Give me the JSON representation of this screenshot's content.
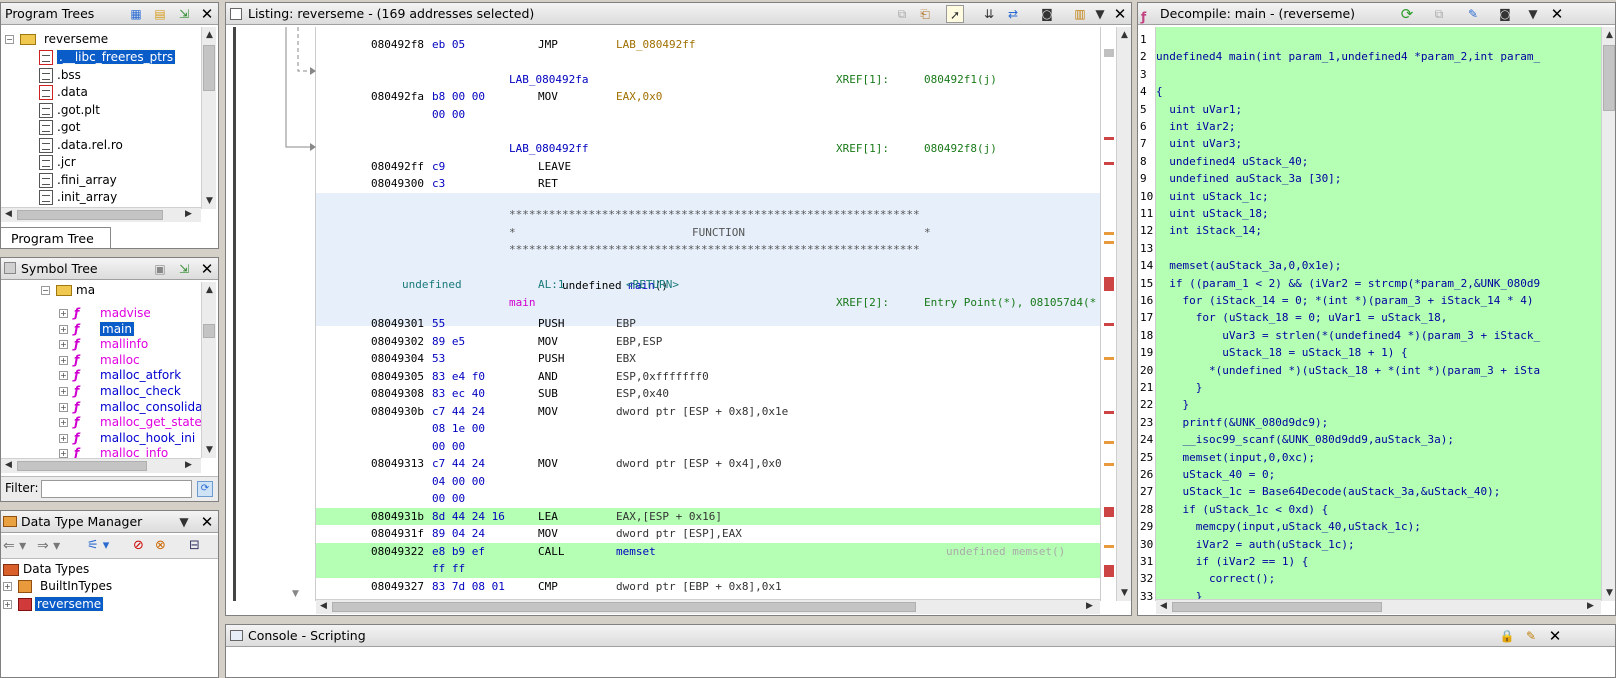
{
  "program_trees": {
    "title": "Program Trees",
    "root": "reverseme",
    "items": [
      ".__libc_freeres_ptrs",
      ".bss",
      ".data",
      ".got.plt",
      ".got",
      ".data.rel.ro",
      ".jcr",
      ".fini_array",
      ".init_array"
    ],
    "tab_label": "Program Tree",
    "tab_close": "×"
  },
  "symbol_tree": {
    "title": "Symbol Tree",
    "folder": "ma",
    "items": [
      "madvise",
      "main",
      "mallinfo",
      "malloc",
      "malloc_atfork",
      "malloc_check",
      "malloc_consolidate",
      "malloc_get_state",
      "malloc_hook_ini",
      "malloc_info"
    ],
    "filter_label": "Filter:",
    "filter_value": ""
  },
  "data_type_manager": {
    "title": "Data Type Manager",
    "root": "Data Types",
    "items": [
      "BuiltInTypes",
      "reverseme"
    ]
  },
  "listing": {
    "title": "Listing:  reverseme - (169 addresses selected)",
    "lines": [
      {
        "addr": "080492f8",
        "bytes": "eb 05",
        "mn": "JMP",
        "op": "LAB_080492ff",
        "cmt": ""
      },
      {
        "label": "LAB_080492fa",
        "xref": "XREF[1]:",
        "xref_val": "080492f1(j)"
      },
      {
        "addr": "080492fa",
        "bytes": "b8 00 00",
        "mn": "MOV",
        "op": "EAX,0x0",
        "cmt": ""
      },
      {
        "addr": "",
        "bytes": "00 00",
        "mn": "",
        "op": "",
        "cmt": ""
      },
      {
        "label": "LAB_080492ff",
        "xref": "XREF[1]:",
        "xref_val": "080492f8(j)"
      },
      {
        "addr": "080492ff",
        "bytes": "c9",
        "mn": "LEAVE",
        "op": "",
        "cmt": ""
      },
      {
        "addr": "08049300",
        "bytes": "c3",
        "mn": "RET",
        "op": "",
        "cmt": ""
      }
    ],
    "stars": "**************************************************************",
    "func_banner_left": "*",
    "func_banner_word": "FUNCTION",
    "func_banner_right": "*",
    "sig_ret": "undefined",
    "sig_name": "main",
    "sig_parens": "()",
    "ret_type": "undefined",
    "ret_reg": "AL:1",
    "ret_tag": "<RETURN>",
    "fn_label": "main",
    "fn_xref": "XREF[2]:",
    "fn_xref_val": "Entry Point(*), 081057d4(*",
    "body": [
      {
        "addr": "08049301",
        "bytes": "55",
        "mn": "PUSH",
        "op": "EBP",
        "hl": false
      },
      {
        "addr": "08049302",
        "bytes": "89 e5",
        "mn": "MOV",
        "op": "EBP,ESP",
        "hl": false
      },
      {
        "addr": "08049304",
        "bytes": "53",
        "mn": "PUSH",
        "op": "EBX",
        "hl": false
      },
      {
        "addr": "08049305",
        "bytes": "83 e4 f0",
        "mn": "AND",
        "op": "ESP,0xfffffff0",
        "hl": false
      },
      {
        "addr": "08049308",
        "bytes": "83 ec 40",
        "mn": "SUB",
        "op": "ESP,0x40",
        "hl": false
      },
      {
        "addr": "0804930b",
        "bytes": "c7 44 24",
        "mn": "MOV",
        "op": "dword ptr [ESP + 0x8],0x1e",
        "hl": false
      },
      {
        "addr": "",
        "bytes": "08 1e 00",
        "mn": "",
        "op": "",
        "hl": false
      },
      {
        "addr": "",
        "bytes": "00 00",
        "mn": "",
        "op": "",
        "hl": false
      },
      {
        "addr": "08049313",
        "bytes": "c7 44 24",
        "mn": "MOV",
        "op": "dword ptr [ESP + 0x4],0x0",
        "hl": false
      },
      {
        "addr": "",
        "bytes": "04 00 00",
        "mn": "",
        "op": "",
        "hl": false
      },
      {
        "addr": "",
        "bytes": "00 00",
        "mn": "",
        "op": "",
        "hl": false
      },
      {
        "addr": "0804931b",
        "bytes": "8d 44 24 16",
        "mn": "LEA",
        "op": "EAX,[ESP + 0x16]",
        "hl": true
      },
      {
        "addr": "0804931f",
        "bytes": "89 04 24",
        "mn": "MOV",
        "op": "dword ptr [ESP],EAX",
        "hl": false
      },
      {
        "addr": "08049322",
        "bytes": "e8 b9 ef",
        "mn": "CALL",
        "op": "memset",
        "hl": true,
        "cmt": "undefined memset()"
      },
      {
        "addr": "",
        "bytes": "ff ff",
        "mn": "",
        "op": "",
        "hl": true
      },
      {
        "addr": "08049327",
        "bytes": "83 7d 08 01",
        "mn": "CMP",
        "op": "dword ptr [EBP + 0x8],0x1",
        "hl": false
      }
    ]
  },
  "decompile": {
    "title": "Decompile: main -  (reverseme)",
    "lines": [
      "",
      "undefined4 main(int param_1,undefined4 *param_2,int param_",
      "",
      "{",
      "  uint uVar1;",
      "  int iVar2;",
      "  uint uVar3;",
      "  undefined4 uStack_40;",
      "  undefined auStack_3a [30];",
      "  uint uStack_1c;",
      "  uint uStack_18;",
      "  int iStack_14;",
      "",
      "  memset(auStack_3a,0,0x1e);",
      "  if ((param_1 < 2) && (iVar2 = strcmp(*param_2,&UNK_080d9",
      "    for (iStack_14 = 0; *(int *)(param_3 + iStack_14 * 4)",
      "      for (uStack_18 = 0; uVar1 = uStack_18,",
      "          uVar3 = strlen(*(undefined4 *)(param_3 + iStack_",
      "          uStack_18 = uStack_18 + 1) {",
      "        *(undefined *)(uStack_18 + *(int *)(param_3 + iSta",
      "      }",
      "    }",
      "    printf(&UNK_080d9dc9);",
      "    __isoc99_scanf(&UNK_080d9dd9,auStack_3a);",
      "    memset(input,0,0xc);",
      "    uStack_40 = 0;",
      "    uStack_1c = Base64Decode(auStack_3a,&uStack_40);",
      "    if (uStack_1c < 0xd) {",
      "      memcpy(input,uStack_40,uStack_1c);",
      "      iVar2 = auth(uStack_1c);",
      "      if (iVar2 == 1) {",
      "        correct();",
      "      }"
    ],
    "line_numbers": [
      "1",
      "2",
      "3",
      "4",
      "5",
      "6",
      "7",
      "8",
      "9",
      "10",
      "11",
      "12",
      "13",
      "14",
      "15",
      "16",
      "17",
      "18",
      "19",
      "20",
      "21",
      "22",
      "23",
      "24",
      "25",
      "26",
      "27",
      "28",
      "29",
      "30",
      "31",
      "32",
      "33"
    ]
  },
  "console": {
    "title": "Console - Scripting"
  },
  "colors": {
    "decompile_bg": "#b4ffb4",
    "listing_highlight": "#b4ffb4",
    "function_header_bg": "#e6effa",
    "selection": "#0a5cc9"
  }
}
